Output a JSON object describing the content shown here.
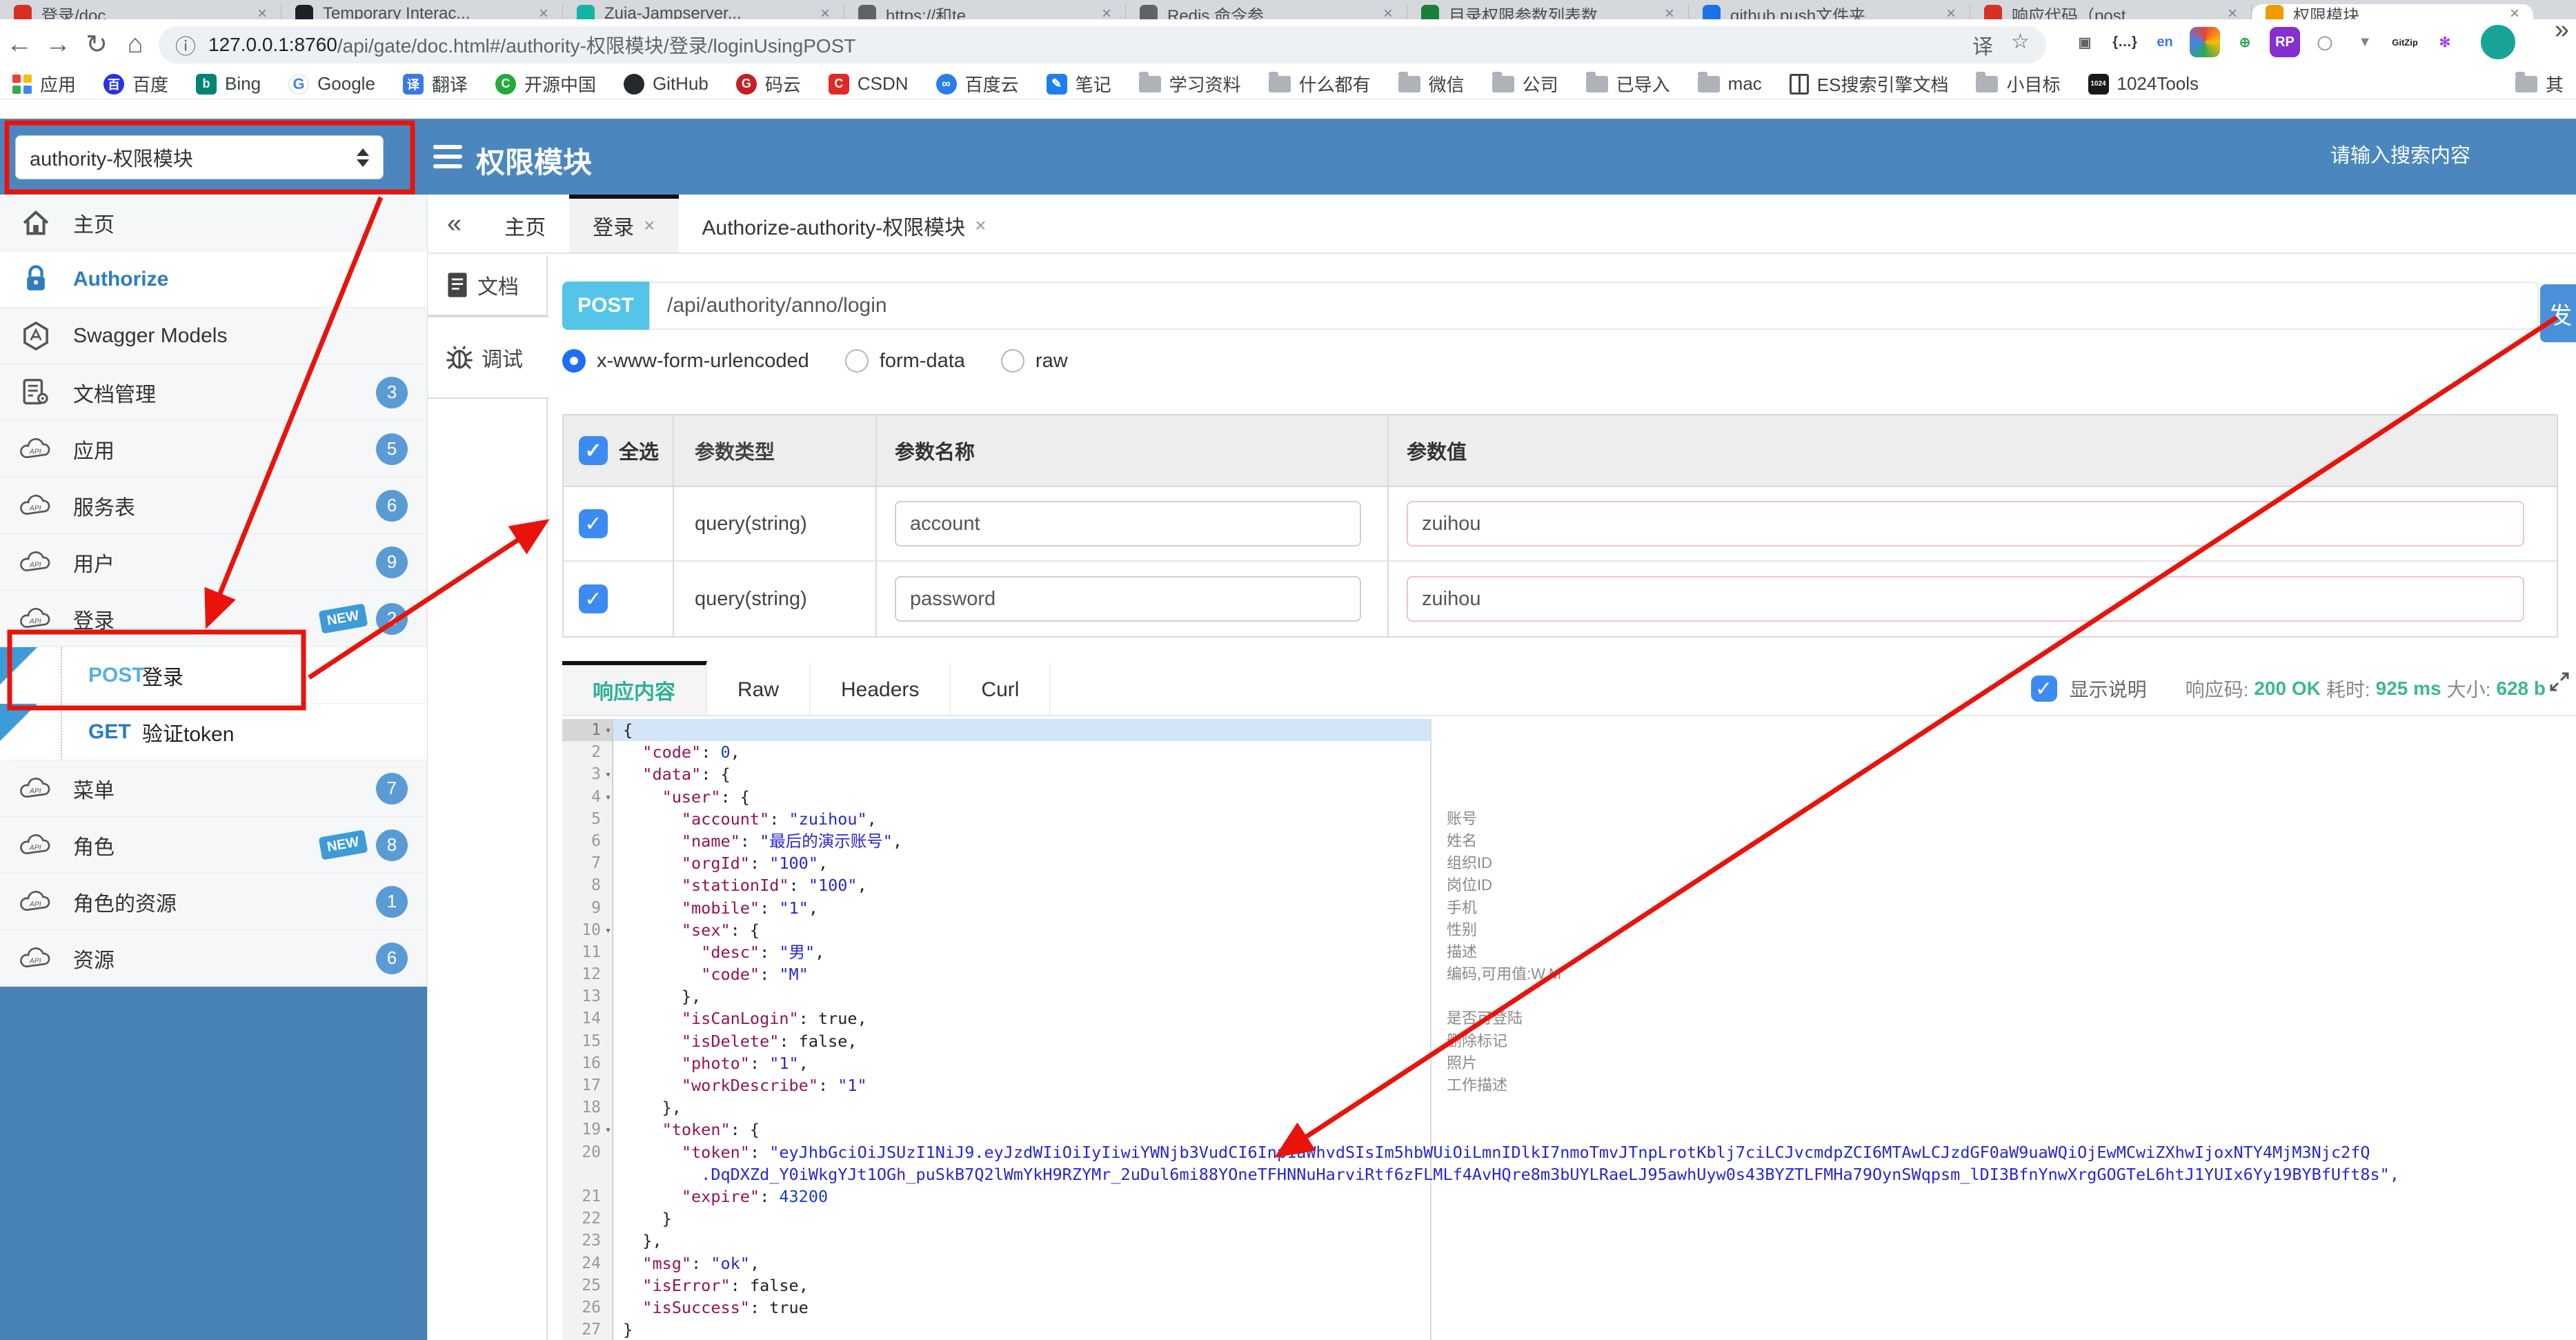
{
  "colors": {
    "header_blue": "#4b87be",
    "sidebar_badge": "#5b9bd5",
    "post_badge_cyan": "#54c5e8",
    "send_button_blue": "#4a90d9",
    "status_green": "#3dba85",
    "annotation_red": "#e8140c",
    "active_response_tab": "#2ab195",
    "json_key": "#941352",
    "json_string": "#2727cf",
    "json_number": "#173fc0"
  },
  "icons": {
    "close": "×",
    "chevron_left": "«",
    "chevron_right": "»",
    "fold": "▾",
    "info": "ⓘ",
    "star": "☆",
    "back": "←",
    "forward": "→",
    "reload": "↻",
    "home": "⌂",
    "check": "✓",
    "translate": "译"
  },
  "browser": {
    "tabs": [
      {
        "label": "登录/doc...",
        "color": "#d93025"
      },
      {
        "label": "Temporary Interac...",
        "color": "#202124"
      },
      {
        "label": "Zuia-Jampserver...",
        "color": "#12b5a5"
      },
      {
        "label": "https://和te...",
        "color": "#5f6368"
      },
      {
        "label": "Redis 命令参...",
        "color": "#5f6368"
      },
      {
        "label": "目录权限参数列表数...",
        "color": "#188038"
      },
      {
        "label": "github push文件夹...",
        "color": "#1a73e8"
      },
      {
        "label": "响应代码（post...",
        "color": "#d93025"
      },
      {
        "label": "权限模块",
        "color": "#f29900",
        "active": true
      }
    ],
    "url_host": "127.0.0.1:8760",
    "url_rest": "/api/gate/doc.html#/authority-权限模块/登录/loginUsingPOST",
    "bookmarks": [
      {
        "label": "应用",
        "icon": "apps-grid"
      },
      {
        "label": "百度",
        "icon": "circle",
        "color": "#2932e1",
        "glyph": "百"
      },
      {
        "label": "Bing",
        "icon": "square",
        "color": "#008373",
        "glyph": "b"
      },
      {
        "label": "Google",
        "icon": "g"
      },
      {
        "label": "翻译",
        "icon": "square",
        "color": "#3b78e7",
        "glyph": "译"
      },
      {
        "label": "开源中国",
        "icon": "circle",
        "color": "#21ab38",
        "glyph": "C"
      },
      {
        "label": "GitHub",
        "icon": "circle",
        "color": "#24292e",
        "glyph": ""
      },
      {
        "label": "码云",
        "icon": "circle",
        "color": "#c71d23",
        "glyph": "G"
      },
      {
        "label": "CSDN",
        "icon": "square",
        "color": "#e32722",
        "glyph": "C"
      },
      {
        "label": "百度云",
        "icon": "circle",
        "color": "#2b7ce9",
        "glyph": "∞"
      },
      {
        "label": "笔记",
        "icon": "square",
        "color": "#1d7ef2",
        "glyph": "✎"
      },
      {
        "label": "学习资料",
        "icon": "folder"
      },
      {
        "label": "什么都有",
        "icon": "folder"
      },
      {
        "label": "微信",
        "icon": "folder"
      },
      {
        "label": "公司",
        "icon": "folder"
      },
      {
        "label": "已导入",
        "icon": "folder"
      },
      {
        "label": "mac",
        "icon": "folder"
      },
      {
        "label": "ES搜索引擎文档",
        "icon": "book"
      },
      {
        "label": "小目标",
        "icon": "folder"
      },
      {
        "label": "1024Tools",
        "icon": "square",
        "color": "#17181a",
        "glyph": "1024"
      },
      {
        "label": "其",
        "icon": "folder",
        "right": true
      }
    ],
    "extensions": [
      {
        "name": "pip-icon",
        "bg": "#ffffff",
        "fg": "#5f6368",
        "glyph": "▣"
      },
      {
        "name": "braces-icon",
        "bg": "#ffffff",
        "fg": "#333333",
        "glyph": "{…}"
      },
      {
        "name": "translate-en-icon",
        "bg": "#ffffff",
        "fg": "#3b78e7",
        "glyph": "en"
      },
      {
        "name": "colorful-circle-icon",
        "bg": "multi",
        "fg": "#ffffff",
        "glyph": ""
      },
      {
        "name": "globe-icon",
        "bg": "#ffffff",
        "fg": "#34a853",
        "glyph": "⊕"
      },
      {
        "name": "rp-icon",
        "bg": "#8430ce",
        "fg": "#ffffff",
        "glyph": "RP"
      },
      {
        "name": "ring-icon",
        "bg": "#ffffff",
        "fg": "#9aa0a6",
        "glyph": "◯"
      },
      {
        "name": "shield-icon",
        "bg": "#ffffff",
        "fg": "#80868b",
        "glyph": "▼"
      },
      {
        "name": "gitzip-icon",
        "bg": "#ffffff",
        "fg": "#202124",
        "glyph": "GitZip"
      },
      {
        "name": "asterisk-icon",
        "bg": "#ffffff",
        "fg": "#a142f4",
        "glyph": "✻"
      }
    ]
  },
  "header": {
    "service_select": "authority-权限模块",
    "title": "权限模块",
    "search_placeholder": "请输入搜索内容"
  },
  "sidebar": {
    "items": [
      {
        "icon": "home",
        "label": "主页"
      },
      {
        "icon": "lock",
        "label": "Authorize",
        "auth": true
      },
      {
        "icon": "hexagon",
        "label": "Swagger Models"
      },
      {
        "icon": "docgear",
        "label": "文档管理",
        "badge": "3"
      },
      {
        "icon": "cloud",
        "label": "应用",
        "badge": "5"
      },
      {
        "icon": "cloud",
        "label": "服务表",
        "badge": "6"
      },
      {
        "icon": "cloud",
        "label": "用户",
        "badge": "9"
      },
      {
        "icon": "cloud",
        "label": "登录",
        "badge": "2",
        "isNew": true,
        "children": [
          {
            "method": "POST",
            "label": "登录",
            "isNew": true
          },
          {
            "method": "GET",
            "label": "验证token",
            "isNew": true
          }
        ]
      },
      {
        "icon": "cloud",
        "label": "菜单",
        "badge": "7"
      },
      {
        "icon": "cloud",
        "label": "角色",
        "badge": "8",
        "isNew": true
      },
      {
        "icon": "cloud",
        "label": "角色的资源",
        "badge": "1"
      },
      {
        "icon": "cloud",
        "label": "资源",
        "badge": "6"
      }
    ]
  },
  "doc_tabs": [
    {
      "label": "主页",
      "closable": false
    },
    {
      "label": "登录",
      "closable": true,
      "active": true
    },
    {
      "label": "Authorize-authority-权限模块",
      "closable": true
    }
  ],
  "side_tabs": [
    {
      "label": "文档",
      "icon": "doc"
    },
    {
      "label": "调试",
      "icon": "bug",
      "active": true
    }
  ],
  "endpoint": {
    "method": "POST",
    "path": "/api/authority/anno/login",
    "send_label": "发"
  },
  "body_types": {
    "options": [
      "x-www-form-urlencoded",
      "form-data",
      "raw"
    ],
    "selected": 0
  },
  "params": {
    "select_all_label": "全选",
    "columns": [
      "参数类型",
      "参数名称",
      "参数值"
    ],
    "rows": [
      {
        "checked": true,
        "type": "query(string)",
        "name": "account",
        "value": "zuihou"
      },
      {
        "checked": true,
        "type": "query(string)",
        "name": "password",
        "value": "zuihou"
      }
    ]
  },
  "response": {
    "tabs": [
      "响应内容",
      "Raw",
      "Headers",
      "Curl"
    ],
    "active_tab": 0,
    "show_desc_label": "显示说明",
    "show_desc_checked": true,
    "code_label": "响应码:",
    "code_value": "200 OK",
    "time_label": "耗时:",
    "time_value": "925 ms",
    "size_label": "大小:",
    "size_value": "628 b"
  },
  "code": {
    "lines": [
      {
        "n": 1,
        "text": "{",
        "fold": true,
        "selected": true
      },
      {
        "n": 2,
        "text": "  \"code\": 0,"
      },
      {
        "n": 3,
        "text": "  \"data\": {",
        "fold": true
      },
      {
        "n": 4,
        "text": "    \"user\": {",
        "fold": true
      },
      {
        "n": 5,
        "text": "      \"account\": \"zuihou\",",
        "ann": "账号"
      },
      {
        "n": 6,
        "text": "      \"name\": \"最后的演示账号\",",
        "ann": "姓名"
      },
      {
        "n": 7,
        "text": "      \"orgId\": \"100\",",
        "ann": "组织ID"
      },
      {
        "n": 8,
        "text": "      \"stationId\": \"100\",",
        "ann": "岗位ID"
      },
      {
        "n": 9,
        "text": "      \"mobile\": \"1\",",
        "ann": "手机"
      },
      {
        "n": 10,
        "text": "      \"sex\": {",
        "fold": true,
        "ann": "性别"
      },
      {
        "n": 11,
        "text": "        \"desc\": \"男\",",
        "ann": "描述"
      },
      {
        "n": 12,
        "text": "        \"code\": \"M\"",
        "ann": "编码,可用值:W,M"
      },
      {
        "n": 13,
        "text": "      },"
      },
      {
        "n": 14,
        "text": "      \"isCanLogin\": true,",
        "ann": "是否可登陆"
      },
      {
        "n": 15,
        "text": "      \"isDelete\": false,",
        "ann": "删除标记"
      },
      {
        "n": 16,
        "text": "      \"photo\": \"1\",",
        "ann": "照片"
      },
      {
        "n": 17,
        "text": "      \"workDescribe\": \"1\"",
        "ann": "工作描述"
      },
      {
        "n": 18,
        "text": "    },"
      },
      {
        "n": 19,
        "text": "    \"token\": {",
        "fold": true
      },
      {
        "n": 20,
        "text": "      \"token\": \"eyJhbGciOiJSUzI1NiJ9.eyJzdWIiOiIyIiwiYWNjb3VudCI6Inp1aWhvdSIsIm5hbWUiOiLmnIDlkI7nmoTmvJTnpLrotKblj7ciLCJvcmdpZCI6MTAwLCJzdGF0aW9uaWQiOjEwMCwiZXhwIjoxNTY4MjM3Njc2fQ",
        "strTail": true,
        "wrap": "        .DqDXZd_Y0iWkgYJt1OGh_puSkB7Q2lWmYkH9RZYMr_2uDul6mi88YOneTFHNNuHarviRtf6zFLMLf4AvHQre8m3bUYLRaeLJ95awhUyw0s43BYZTLFMHa79OynSWqpsm_lDI3BfnYnwXrgGOGTeL6htJ1YUIx6Yy19BYBfUft8s\","
      },
      {
        "n": 21,
        "text": "      \"expire\": 43200"
      },
      {
        "n": 22,
        "text": "    }"
      },
      {
        "n": 23,
        "text": "  },"
      },
      {
        "n": 24,
        "text": "  \"msg\": \"ok\","
      },
      {
        "n": 25,
        "text": "  \"isError\": false,"
      },
      {
        "n": 26,
        "text": "  \"isSuccess\": true"
      },
      {
        "n": 27,
        "text": "}"
      }
    ]
  }
}
